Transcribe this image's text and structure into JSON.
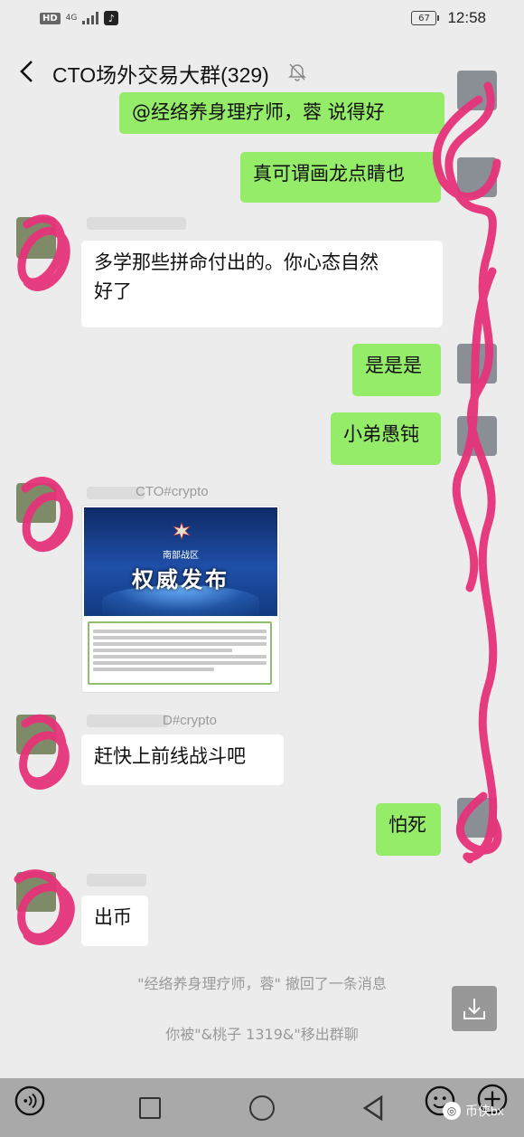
{
  "status_bar": {
    "network": "4G",
    "battery": "67",
    "time": "12:58"
  },
  "header": {
    "title": "CTO场外交易大群(329)"
  },
  "messages": [
    {
      "side": "right",
      "text": "@经络养身理疗师，蓉  说得好"
    },
    {
      "side": "right",
      "text": "真可谓画龙点睛也"
    },
    {
      "side": "left",
      "text": "多学那些拼命付出的。你心态自然\n好了"
    },
    {
      "side": "right",
      "text": "是是是"
    },
    {
      "side": "right",
      "text": "小弟愚钝"
    },
    {
      "side": "left",
      "nickname": "CTO#crypto",
      "share": {
        "subtitle": "南部战区",
        "title": "权威发布"
      }
    },
    {
      "side": "left",
      "nickname": "D#crypto",
      "text": "赶快上前线战斗吧"
    },
    {
      "side": "right",
      "text": "怕死"
    },
    {
      "side": "left",
      "text": "出币"
    }
  ],
  "system_messages": [
    "\"经络养身理疗师，蓉\" 撤回了一条消息",
    "你被\"&桃子 1319&\"移出群聊"
  ],
  "watermark": {
    "text": "币侠bx"
  },
  "colors": {
    "green_bubble": "#95ec69",
    "scribble": "#e6337a"
  }
}
